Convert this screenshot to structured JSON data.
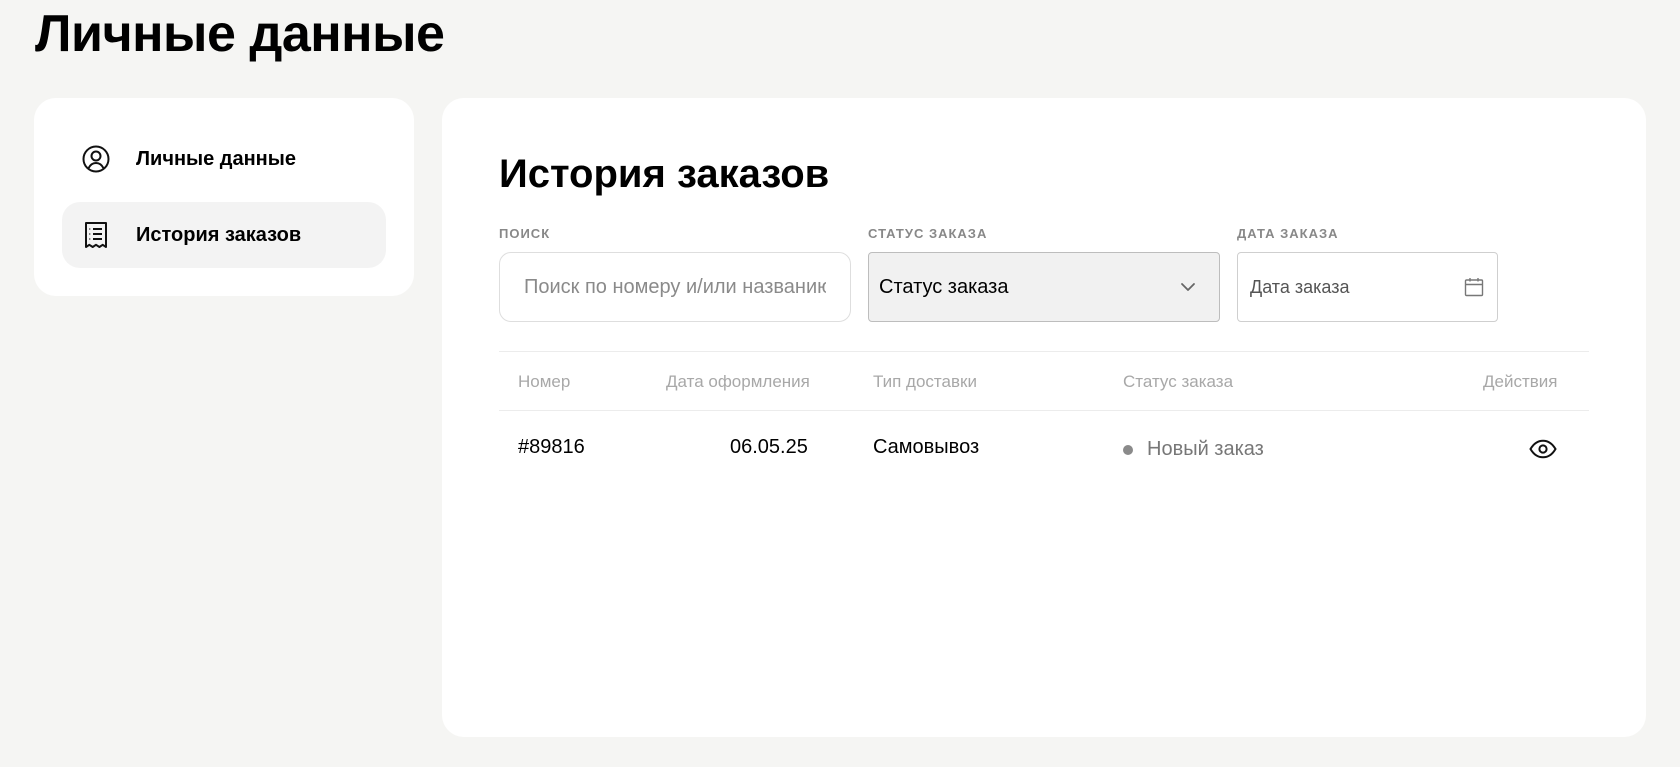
{
  "page": {
    "title": "Личные данные"
  },
  "sidebar": {
    "items": [
      {
        "label": "Личные данные",
        "icon": "user-circle-icon",
        "active": false
      },
      {
        "label": "История заказов",
        "icon": "receipt-icon",
        "active": true
      }
    ]
  },
  "main": {
    "title": "История заказов",
    "filters": {
      "search": {
        "label": "ПОИСК",
        "placeholder": "Поиск по номеру и/или названию",
        "value": ""
      },
      "status": {
        "label": "СТАТУС ЗАКАЗА",
        "value": "Статус заказа"
      },
      "date": {
        "label": "ДАТА ЗАКАЗА",
        "placeholder": "Дата заказа"
      }
    },
    "table": {
      "headers": [
        "Номер",
        "Дата оформления",
        "Тип доставки",
        "Статус заказа",
        "Действия"
      ],
      "rows": [
        {
          "number": "#89816",
          "date": "06.05.25",
          "delivery": "Самовывоз",
          "status": "Новый заказ"
        }
      ]
    }
  },
  "colors": {
    "background": "#f5f5f3",
    "card": "#ffffff",
    "active_item": "#f3f3f3",
    "status_dot": "#8a8a8a"
  }
}
